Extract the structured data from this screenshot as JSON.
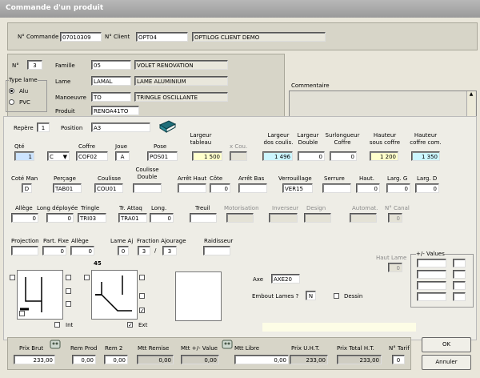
{
  "window": {
    "title": "Commande d'un produit"
  },
  "header": {
    "num_commande_label": "N° Commande",
    "num_commande": "07010309",
    "num_client_label": "N° Client",
    "num_client": "OPT04",
    "client_name": "OPTILOG CLIENT DEMO"
  },
  "line": {
    "n_label": "N°",
    "n_value": "3",
    "type_lame_label": "Type lame",
    "alu_label": "Alu",
    "pvc_label": "PVC",
    "famille_label": "Famille",
    "famille_code": "05",
    "famille_name": "VOLET RENOVATION",
    "lame_label": "Lame",
    "lame_code": "LAMAL",
    "lame_name": "LAME ALUMINIUM",
    "manoeuvre_label": "Manoeuvre",
    "manoeuvre_code": "TO",
    "manoeuvre_name": "TRINGLE OSCILLANTE",
    "produit_label": "Produit",
    "produit_code": "RENOA41TO",
    "commentaire_label": "Commentaire"
  },
  "form": {
    "repere_label": "Repère",
    "repere_value": "1",
    "position_label": "Position",
    "position_value": "A3",
    "row1": {
      "qte_label": "Qté",
      "qte_value": "1",
      "combo_value": "C",
      "coffre_label": "Coffre",
      "coffre_value": "COF02",
      "joue_label": "Joue",
      "joue_value": "A",
      "pose_label": "Pose",
      "pose_value": "POS01",
      "largeur_tableau_label": "Largeur\ntableau",
      "largeur_tableau_value": "1 500",
      "x_cou_label": "x Cou.",
      "largeur_couliss_label": "Largeur\ndos coulis.",
      "largeur_couliss_value": "1 496",
      "largeur_double_label": "Largeur\nDouble",
      "largeur_double_value": "0",
      "surlongueur_label": "Surlongueur\nCoffre",
      "surlongueur_value": "0",
      "hauteur_sous_label": "Hauteur\nsous coffre",
      "hauteur_sous_value": "1 200",
      "hauteur_com_label": "Hauteur\ncoffre com.",
      "hauteur_com_value": "1 350"
    },
    "row2": {
      "cote_man_label": "Coté Man",
      "cote_man_value": "D",
      "percage_label": "Perçage",
      "percage_value": "TAB01",
      "coulisse_label": "Coulisse",
      "coulisse_value": "COU01",
      "coulisse_double_label": "Coulisse\nDouble",
      "arret_haut_label": "Arrêt Haut",
      "cote_label": "Côte",
      "cote_value": "0",
      "arret_bas_label": "Arrêt Bas",
      "verrouillage_label": "Verrouillage",
      "verrouillage_value": "VER15",
      "serrure_label": "Serrure",
      "haut_label": "Haut.",
      "haut_value": "0",
      "larg_g_label": "Larg. G",
      "larg_g_value": "0",
      "larg_d_label": "Larg. D",
      "larg_d_value": "0"
    },
    "row3": {
      "allege_label": "Allège",
      "allege_value": "0",
      "long_deployee_label": "Long déployée",
      "long_deployee_value": "0",
      "tringle_label": "Tringle",
      "tringle_value": "TRI03",
      "tr_attaq_label": "Tr. Attaq",
      "tr_attaq_value": "TRA01",
      "long_label": "Long.",
      "long_value": "0",
      "treuil_label": "Treuil",
      "motorisation_label": "Motorisation",
      "inverseur_label": "Inverseur",
      "design_label": "Design",
      "automat_label": "Automat.",
      "n_canal_label": "N° Canal",
      "n_canal_value": "0"
    },
    "row4": {
      "projection_label": "Projection",
      "part_fixe_label": "Part. Fixe",
      "part_fixe_value": "0",
      "allege2_label": "Allège",
      "allege2_value": "0",
      "lame_aj_label": "Lame Aj",
      "lame_aj_value": "0",
      "fraction_label": "Fraction Ajourage",
      "fraction_num": "3",
      "fraction_den": "3",
      "slash": "/",
      "raidisseur_label": "Raidisseur",
      "haut_lame_label": "Haut Lame",
      "haut_lame_value": "0",
      "plus_minus_label": "+/- Values"
    },
    "diagram": {
      "angle_label": "45",
      "int_label": "Int",
      "ext_label": "Ext",
      "axe_label": "Axe",
      "axe_value": "AXE20",
      "embout_label": "Embout Lames ?",
      "embout_value": "N",
      "dessin_label": "Dessin"
    }
  },
  "footer": {
    "prix_brut_label": "Prix Brut",
    "prix_brut_value": "233,00",
    "rem_prod_label": "Rem Prod",
    "rem_prod_value": "0,00",
    "rem2_label": "Rem 2",
    "rem2_value": "0,00",
    "mtt_remise_label": "Mtt Remise",
    "mtt_remise_value": "0,00",
    "mtt_value_label": "Mtt +/- Value",
    "mtt_value_value": "0,00",
    "mtt_libre_label": "Mtt Libre",
    "mtt_libre_value": "0,00",
    "prix_uht_label": "Prix U.H.T.",
    "prix_uht_value": "233,00",
    "prix_total_label": "Prix Total H.T.",
    "prix_total_value": "233,00",
    "n_tarif_label": "N° Tarif",
    "n_tarif_value": "0",
    "ok_label": "OK",
    "annuler_label": "Annuler"
  }
}
